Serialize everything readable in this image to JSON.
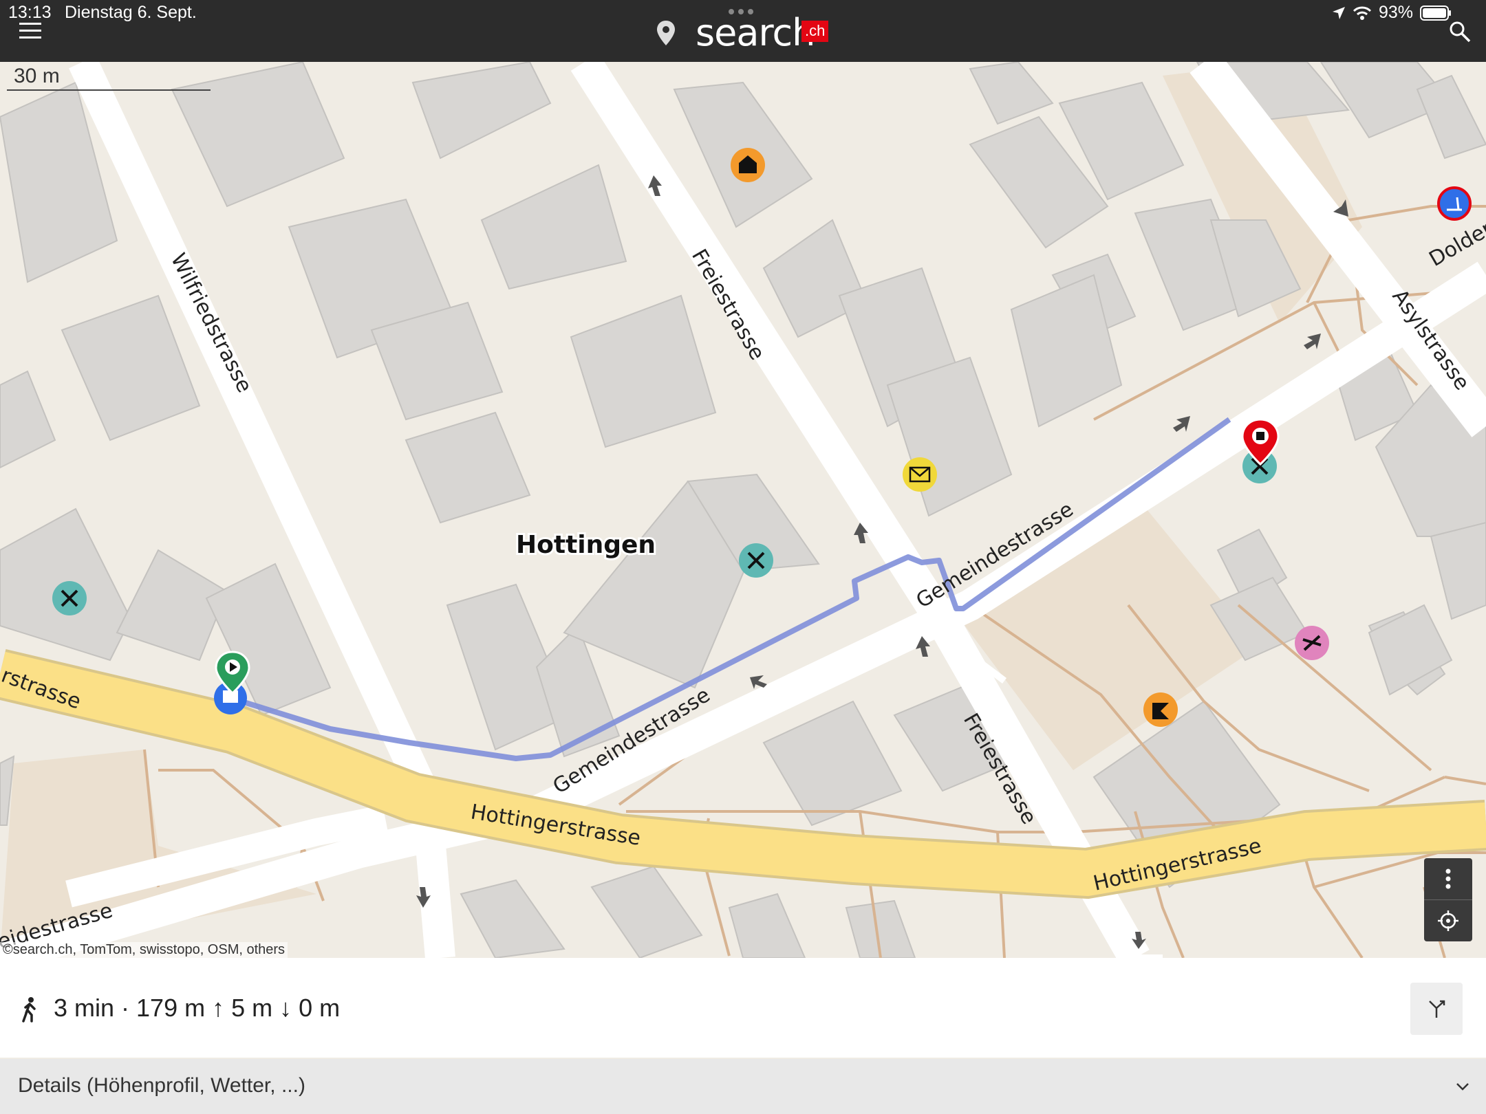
{
  "status_bar": {
    "time": "13:13",
    "date": "Dienstag 6. Sept.",
    "battery": "93%"
  },
  "header": {
    "logo_text": "search",
    "logo_suffix": ".ch"
  },
  "map": {
    "scale_label": "30 m",
    "district_label": "Hottingen",
    "street_labels": {
      "wilfriedstrasse": "Wilfriedstrasse",
      "freiestrasse_top": "Freiestrasse",
      "freiestrasse_bottom": "Freiestrasse",
      "gemeindestrasse_center": "Gemeindestrasse",
      "gemeindestrasse_lower": "Gemeindestrasse",
      "gemeindestrasse_left": "eidestrasse",
      "hottingerstrasse_left": "rstrasse",
      "hottingerstrasse_center": "Hottingerstrasse",
      "hottingerstrasse_right": "Hottingerstrasse",
      "dolder": "Dolder",
      "asylstrasse": "Asylstrasse"
    },
    "attribution": "©search.ch, TomTom, swisstopo, OSM, others",
    "poi_icons": [
      "restaurant-icon",
      "restaurant-icon",
      "restaurant-icon",
      "post-icon",
      "building-icon",
      "playground-icon",
      "bakery-icon",
      "scooter-icon",
      "bus-stop-icon"
    ],
    "colors": {
      "route": "#7f8fd9",
      "main_road": "#fbe087",
      "start_marker": "#2a9d5c",
      "end_marker": "#e30613"
    }
  },
  "route": {
    "summary": "3 min · 179 m ↑ 5 m ↓ 0 m"
  },
  "details": {
    "label": "Details (Höhenprofil, Wetter, ...)"
  }
}
